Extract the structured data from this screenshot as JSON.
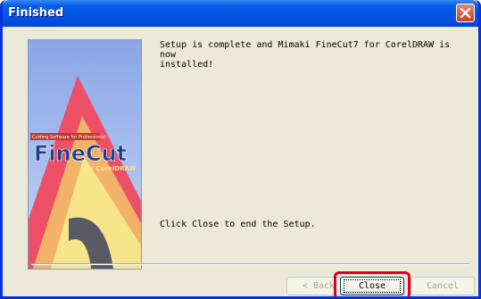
{
  "window": {
    "title": "Finished"
  },
  "banner": {
    "tagline": "Cutting Software for Professional",
    "logo_text": "FineCut",
    "logo_sub": "for CorelDRAW"
  },
  "message": {
    "complete": "Setup is complete and Mimaki FineCut7 for CorelDRAW is now\ninstalled!",
    "instruction": "Click Close to end the Setup."
  },
  "buttons": {
    "back": "< Back",
    "close": "Close",
    "cancel": "Cancel"
  },
  "annotation": {
    "highlight_color": "#e0001b"
  }
}
